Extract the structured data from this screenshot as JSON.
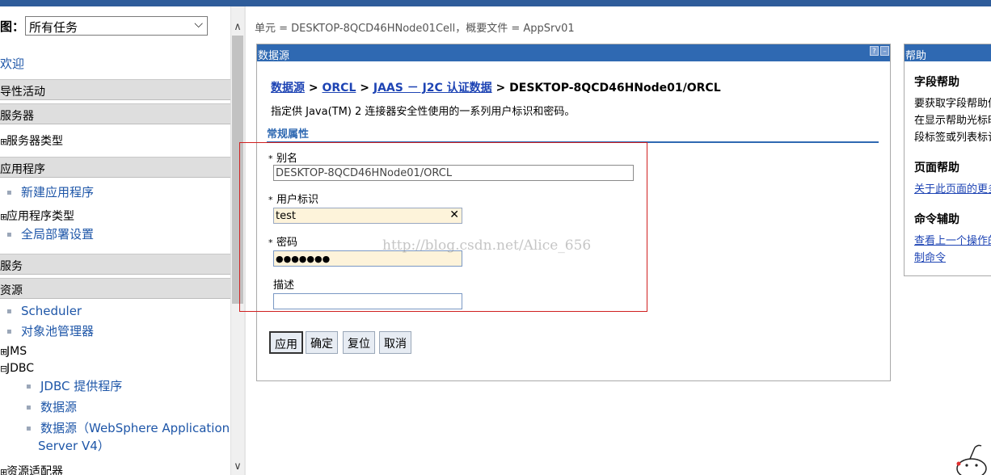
{
  "nav": {
    "view_label": "图：",
    "view_value": "所有任务",
    "welcome": "欢迎",
    "categories": [
      "导性活动",
      "服务器",
      "应用程序",
      "服务",
      "资源"
    ],
    "server_types": "服务器类型",
    "app_links": [
      "新建应用程序",
      "全局部署设置"
    ],
    "app_types": "应用程序类型",
    "resource_links": [
      "Scheduler",
      "对象池管理器"
    ],
    "jms": "JMS",
    "jdbc": "JDBC",
    "jdbc_links": [
      "JDBC 提供程序",
      "数据源",
      "数据源（WebSphere Application",
      "Server V4）"
    ],
    "resource_adapter": "资源适配器"
  },
  "scope_text": "单元 = DESKTOP-8QCD46HNode01Cell，概要文件 = AppSrv01",
  "portlet": {
    "title": "数据源",
    "help_btn": "?",
    "min_btn": "–",
    "breadcrumb": {
      "link1": "数据源",
      "link2": "ORCL",
      "link3": "JAAS － J2C 认证数据",
      "sep": ">",
      "current": "DESKTOP-8QCD46HNode01/ORCL"
    },
    "description": "指定供 Java(TM) 2 连接器安全性使用的一系列用户标识和密码。",
    "section_title": "常规属性",
    "fields": {
      "alias_label": "别名",
      "alias_value": "DESKTOP-8QCD46HNode01/ORCL",
      "userid_label": "用户标识",
      "userid_value": "test",
      "password_label": "密码",
      "password_value": "●●●●●●●",
      "desc_label": "描述",
      "desc_value": "",
      "required_mark": "*",
      "clear_glyph": "✕"
    },
    "buttons": [
      "应用",
      "确定",
      "复位",
      "取消"
    ]
  },
  "watermark": "http://blog.csdn.net/Alice_656",
  "help": {
    "title": "帮助",
    "field_help_title": "字段帮助",
    "field_help_lines": [
      "要获取字段帮助信",
      "在显示帮助光标时",
      "段标签或列表标记"
    ],
    "page_help_title": "页面帮助",
    "page_help_link": "关于此页面的更多",
    "cmd_title": "命令辅助",
    "cmd_links": [
      "查看上一个操作的",
      "制命令"
    ]
  },
  "scrollbar": {
    "up": "∧",
    "down": "∨"
  }
}
